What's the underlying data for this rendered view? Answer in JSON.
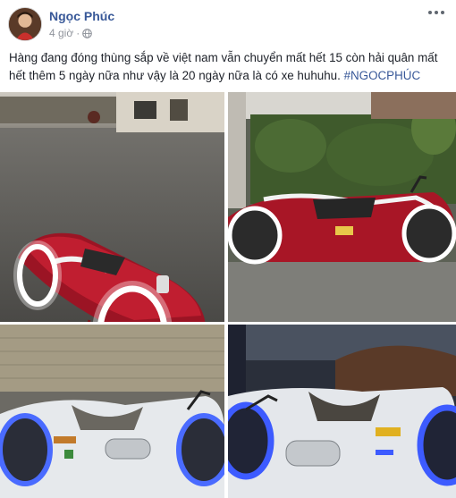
{
  "post": {
    "author": "Ngọc Phúc",
    "time": "4 giờ",
    "separator": "·",
    "text": "Hàng đang đóng thùng sắp về việt nam vẫn chuyển mất hết 15 còn hải quân mất hết thêm 5 ngày nữa như vậy là 20 ngày nữa là có xe huhuhu. ",
    "hashtag": "#NGOCPHÚC"
  },
  "icons": {
    "privacy": "globe-icon",
    "more": "more-options-icon"
  },
  "colors": {
    "author_link": "#385898",
    "meta_text": "#90949c",
    "body_text": "#1d2129",
    "bike_red": "#b0182a",
    "bike_white": "#e9ecef",
    "glow": "#ffffff",
    "glow_blue": "#3d5bff"
  }
}
